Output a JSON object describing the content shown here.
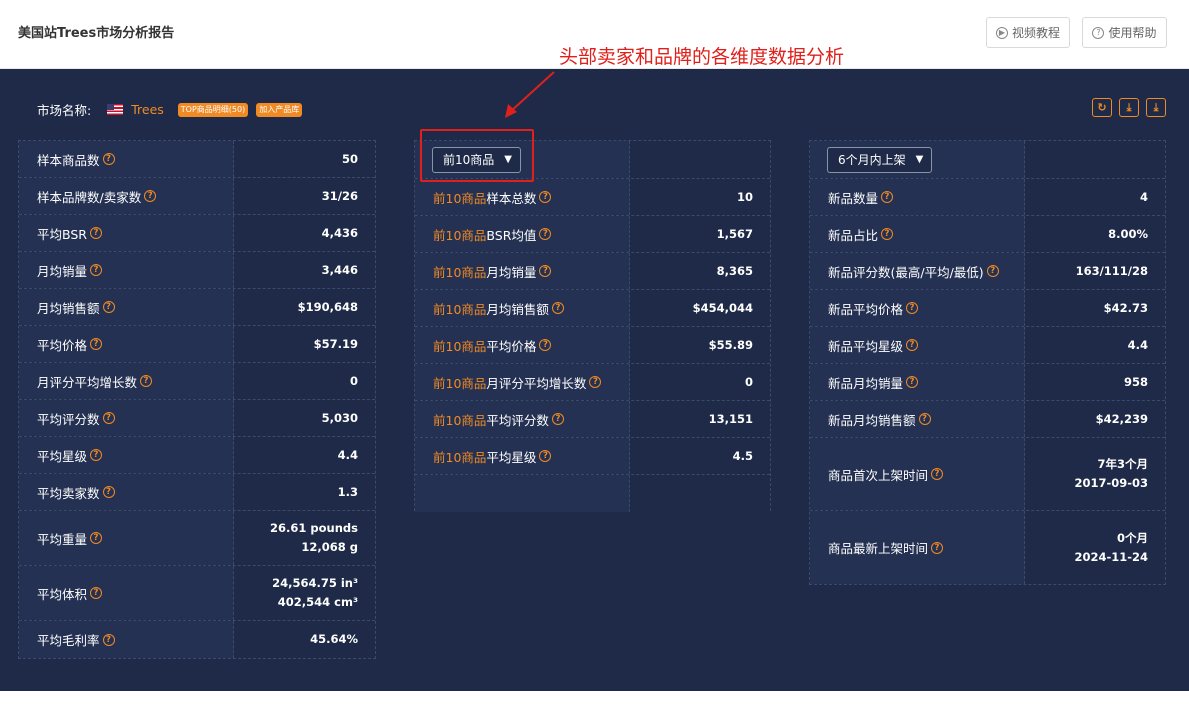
{
  "header": {
    "title": "美国站Trees市场分析报告",
    "video_btn": "视频教程",
    "help_btn": "使用帮助"
  },
  "annotation": "头部卖家和品牌的各维度数据分析",
  "market": {
    "label": "市场名称:",
    "name": "Trees",
    "tag_top": "TOP商品明细(50)",
    "tag_add": "加入产品库"
  },
  "actions": [
    "refresh-icon",
    "download-icon",
    "export-icon"
  ],
  "overall": [
    {
      "label": "样本商品数",
      "value": "50"
    },
    {
      "label": "样本品牌数/卖家数",
      "value": "31/26"
    },
    {
      "label": "平均BSR",
      "value": "4,436"
    },
    {
      "label": "月均销量",
      "value": "3,446"
    },
    {
      "label": "月均销售额",
      "value": "$190,648"
    },
    {
      "label": "平均价格",
      "value": "$57.19"
    },
    {
      "label": "月评分平均增长数",
      "value": "0"
    },
    {
      "label": "平均评分数",
      "value": "5,030"
    },
    {
      "label": "平均星级",
      "value": "4.4"
    },
    {
      "label": "平均卖家数",
      "value": "1.3"
    },
    {
      "label": "平均重量",
      "value": "26.61 pounds",
      "value2": "12,068 g"
    },
    {
      "label": "平均体积",
      "value": "24,564.75 in³",
      "value2": "402,544 cm³"
    },
    {
      "label": "平均毛利率",
      "value": "45.64%"
    }
  ],
  "top10": {
    "select": "前10商品",
    "prefix": "前10商品",
    "rows": [
      {
        "label": "样本总数",
        "value": "10"
      },
      {
        "label": "BSR均值",
        "value": "1,567"
      },
      {
        "label": "月均销量",
        "value": "8,365"
      },
      {
        "label": "月均销售额",
        "value": "$454,044"
      },
      {
        "label": "平均价格",
        "value": "$55.89"
      },
      {
        "label": "月评分平均增长数",
        "value": "0"
      },
      {
        "label": "平均评分数",
        "value": "13,151"
      },
      {
        "label": "平均星级",
        "value": "4.5"
      }
    ]
  },
  "newitems": {
    "select": "6个月内上架",
    "rows": [
      {
        "label": "新品数量",
        "value": "4"
      },
      {
        "label": "新品占比",
        "value": "8.00%"
      },
      {
        "label": "新品评分数(最高/平均/最低)",
        "value": "163/111/28"
      },
      {
        "label": "新品平均价格",
        "value": "$42.73"
      },
      {
        "label": "新品平均星级",
        "value": "4.4"
      },
      {
        "label": "新品月均销量",
        "value": "958"
      },
      {
        "label": "新品月均销售额",
        "value": "$42,239"
      },
      {
        "label": "商品首次上架时间",
        "value": "7年3个月",
        "value2": "2017-09-03"
      },
      {
        "label": "商品最新上架时间",
        "value": "0个月",
        "value2": "2024-11-24"
      }
    ]
  }
}
